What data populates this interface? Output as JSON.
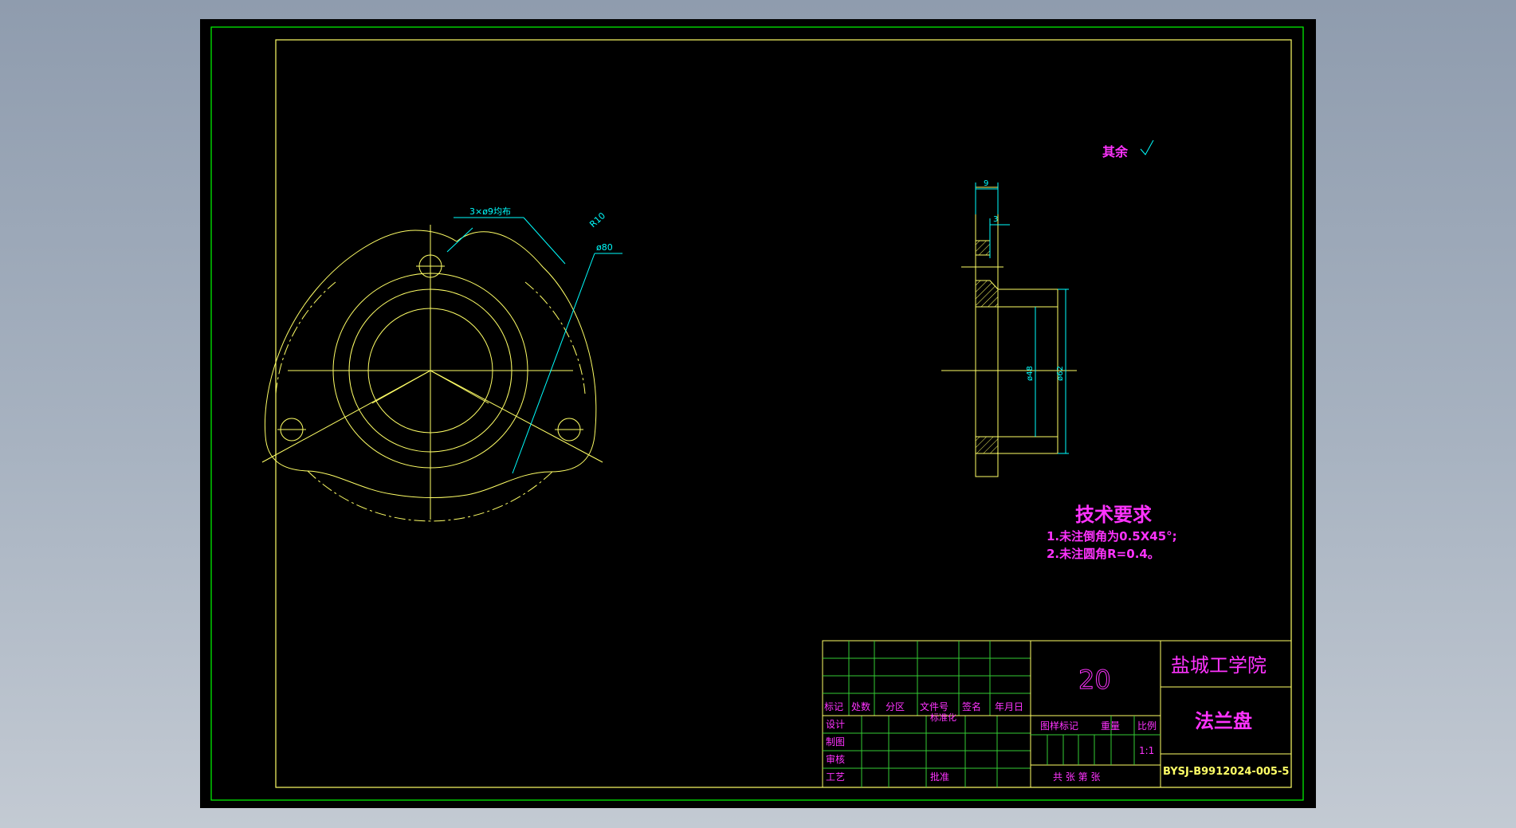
{
  "colors": {
    "sheet_background": "#000000",
    "viewport_background": "#9aa6b6",
    "outer_border": "#00ff00",
    "geometry": "#ffff66",
    "dimension": "#00ffff",
    "text_note": "#ff33ff",
    "title_grid": "#33cc33"
  },
  "front_view": {
    "hole_note": "3×ø9均布",
    "radius_label": "R10",
    "diameter_label": "ø80"
  },
  "side_view": {
    "dims": {
      "width_total": "9",
      "width_step": "3",
      "diameter_inner": "ø48",
      "diameter_outer": "ø62"
    }
  },
  "roughness_note": "其余",
  "roughness_symbol": "roughness-check-symbol",
  "tech_requirements": {
    "title": "技术要求",
    "items": [
      "1.未注倒角为0.5X45°;",
      "2.未注圆角R=0.4。"
    ]
  },
  "title_block": {
    "headers": [
      "标记",
      "处数",
      "分区",
      "文件号",
      "签名",
      "年月日"
    ],
    "design": "设计",
    "standardization": "标准化",
    "drafting": "制图",
    "review": "审核",
    "process": "工艺",
    "approval": "批准",
    "material": "20",
    "school": "盐城工学院",
    "part_name": "法兰盘",
    "drawing_number": "BYSJ-B9912024-005-5",
    "stage_mark": "图样标记",
    "weight": "重量",
    "scale_label": "比例",
    "scale_value": "1:1",
    "sheet_info": "共    张    第    张"
  }
}
